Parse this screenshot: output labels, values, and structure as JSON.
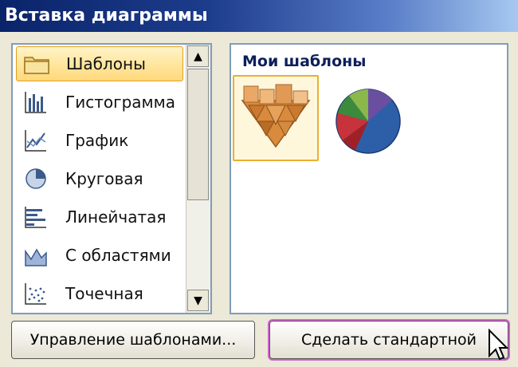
{
  "window": {
    "title": "Вставка диаграммы"
  },
  "chart_types": [
    {
      "label": "Шаблоны",
      "icon": "folder-icon",
      "selected": true
    },
    {
      "label": "Гистограмма",
      "icon": "column-chart-icon"
    },
    {
      "label": "График",
      "icon": "line-chart-icon"
    },
    {
      "label": "Круговая",
      "icon": "pie-chart-icon"
    },
    {
      "label": "Линейчатая",
      "icon": "bar-chart-icon"
    },
    {
      "label": "С областями",
      "icon": "area-chart-icon"
    },
    {
      "label": "Точечная",
      "icon": "scatter-chart-icon"
    }
  ],
  "templates": {
    "heading": "Мои шаблоны",
    "items": [
      {
        "icon": "pyramid-template-icon",
        "selected": true
      },
      {
        "icon": "pie-template-icon"
      }
    ]
  },
  "buttons": {
    "manage_templates": "Управление шаблонами...",
    "set_default": "Сделать стандартной"
  },
  "colors": {
    "title_gradient_start": "#0a246a",
    "selection": "#ffd87a",
    "focus_ring": "#d060d0"
  }
}
